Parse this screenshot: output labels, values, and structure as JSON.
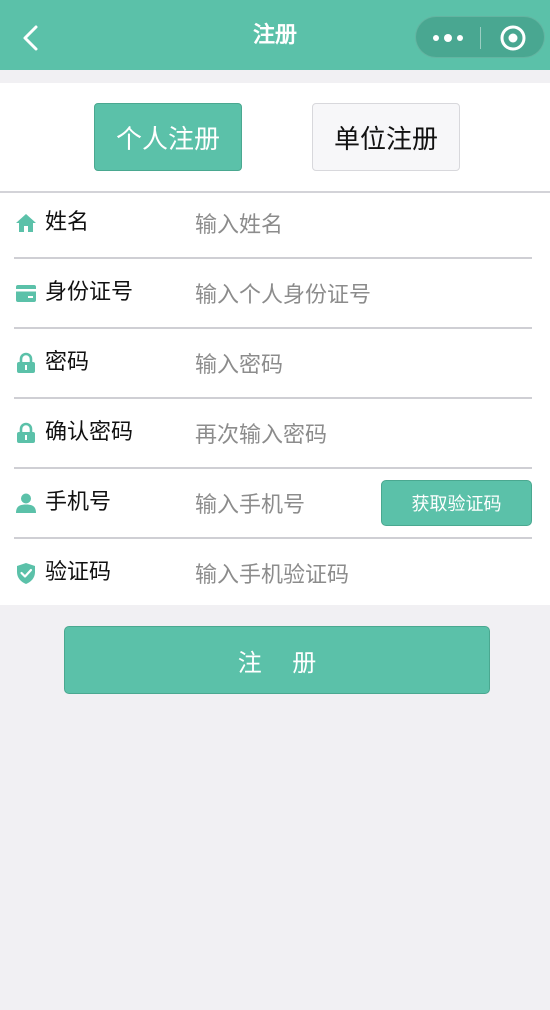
{
  "navbar": {
    "title": "注册",
    "back_icon": "chevron-left-icon",
    "more_icon": "more-dots-icon",
    "close_icon": "target-circle-icon",
    "background": "#5bc1a9"
  },
  "register_type": {
    "personal_label": "个人注册",
    "organization_label": "单位注册",
    "selected": "personal"
  },
  "form": {
    "fields": [
      {
        "label": "姓名",
        "placeholder": "输入姓名",
        "icon": "home-icon"
      },
      {
        "label": "身份证号",
        "placeholder": "输入个人身份证号",
        "icon": "id-card-icon"
      },
      {
        "label": "密码",
        "placeholder": "输入密码",
        "icon": "lock-icon"
      },
      {
        "label": "确认密码",
        "placeholder": "再次输入密码",
        "icon": "lock-icon"
      },
      {
        "label": "手机号",
        "placeholder": "输入手机号",
        "icon": "user-icon"
      },
      {
        "label": "验证码",
        "placeholder": "输入手机验证码",
        "icon": "shield-check-icon"
      }
    ],
    "get_code_label": "获取验证码"
  },
  "submit_label": "注    册",
  "colors": {
    "accent": "#5bc1a9",
    "page_bg": "#f1f0f3",
    "text": "#111111",
    "placeholder": "#8c8c8c"
  }
}
